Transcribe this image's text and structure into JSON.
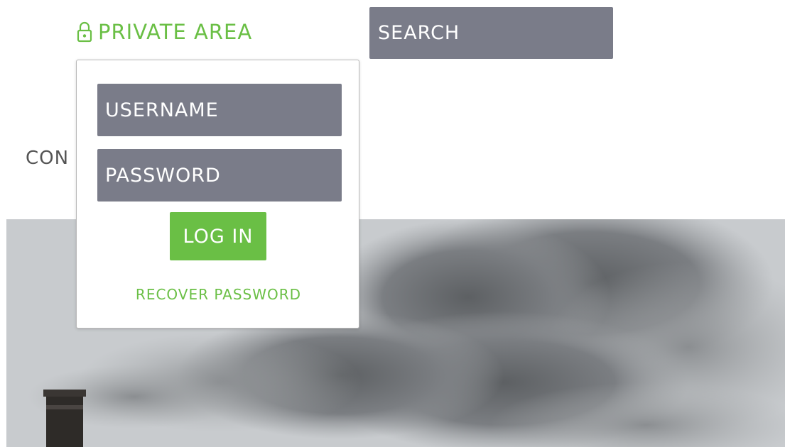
{
  "header": {
    "private_area_label": "PRIVATE AREA",
    "private_area_icon": "lock-icon",
    "accent_color": "#6abf45"
  },
  "search": {
    "placeholder": "SEARCH",
    "icon": "search-icon",
    "background_color": "#7a7c89"
  },
  "nav": {
    "partial_item_label": "CON"
  },
  "login": {
    "username_placeholder": "USERNAME",
    "password_placeholder": "PASSWORD",
    "login_button_label": "LOG IN",
    "recover_password_label": "RECOVER PASSWORD"
  },
  "hero": {
    "image_description_icon": "smokestack-image"
  }
}
